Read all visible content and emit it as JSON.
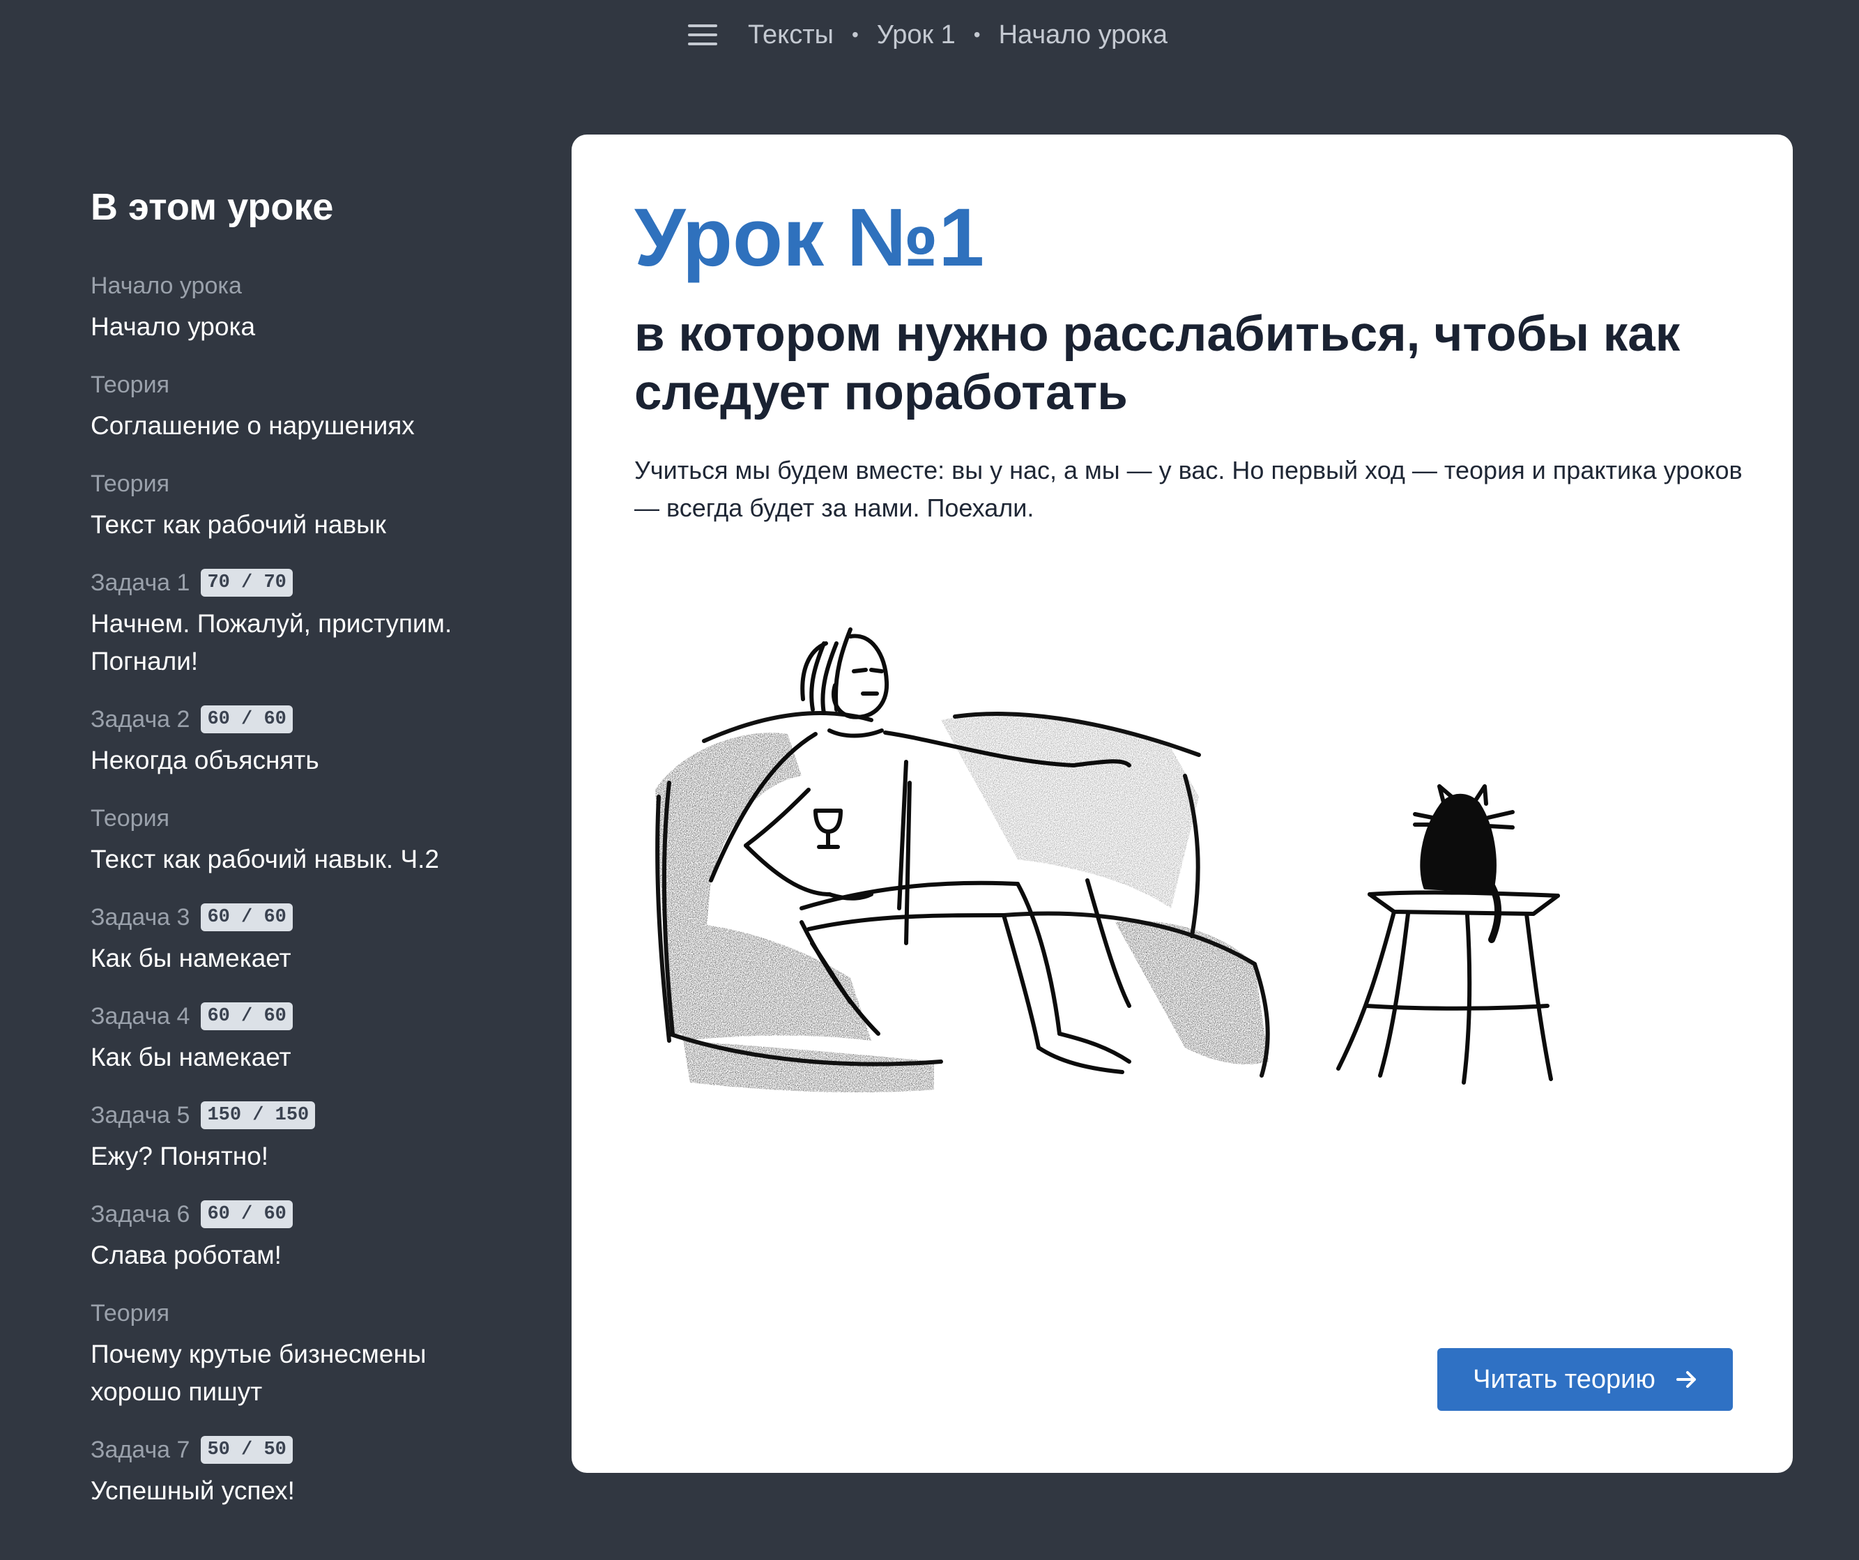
{
  "header": {
    "breadcrumbs": [
      "Тексты",
      "Урок 1",
      "Начало урока"
    ],
    "separator": "•"
  },
  "sidebar": {
    "heading": "В этом уроке",
    "items": [
      {
        "kind": "Начало урока",
        "title": "Начало урока",
        "score": ""
      },
      {
        "kind": "Теория",
        "title": "Соглашение о нарушениях",
        "score": ""
      },
      {
        "kind": "Теория",
        "title": "Текст как рабочий навык",
        "score": ""
      },
      {
        "kind": "Задача 1",
        "title": "Начнем. Пожалуй, приступим. Погнали!",
        "score": "70 / 70"
      },
      {
        "kind": "Задача 2",
        "title": "Некогда объяснять",
        "score": "60 / 60"
      },
      {
        "kind": "Теория",
        "title": "Текст как рабочий навык. Ч.2",
        "score": ""
      },
      {
        "kind": "Задача 3",
        "title": "Как бы намекает",
        "score": "60 / 60"
      },
      {
        "kind": "Задача 4",
        "title": "Как бы намекает",
        "score": "60 / 60"
      },
      {
        "kind": "Задача 5",
        "title": "Ежу? Понятно!",
        "score": "150 / 150"
      },
      {
        "kind": "Задача 6",
        "title": "Слава роботам!",
        "score": "60 / 60"
      },
      {
        "kind": "Теория",
        "title": "Почему крутые бизнесмены хорошо пишут",
        "score": ""
      },
      {
        "kind": "Задача 7",
        "title": "Успешный успех!",
        "score": "50 / 50"
      }
    ]
  },
  "main": {
    "title": "Урок №1",
    "subtitle": "в котором нужно расслабиться, чтобы как следует поработать",
    "intro": "Учиться мы будем вместе: вы у нас, а мы — у вас. Но первый ход — теория и практика уроков — всегда будет за нами. Поехали.",
    "cta_label": "Читать теорию"
  },
  "colors": {
    "background": "#313741",
    "card": "#ffffff",
    "accent": "#2f71bd",
    "button": "#2f71c4",
    "badge": "#dce1e7"
  },
  "icons": [
    "menu-icon",
    "arrow-right-icon"
  ]
}
